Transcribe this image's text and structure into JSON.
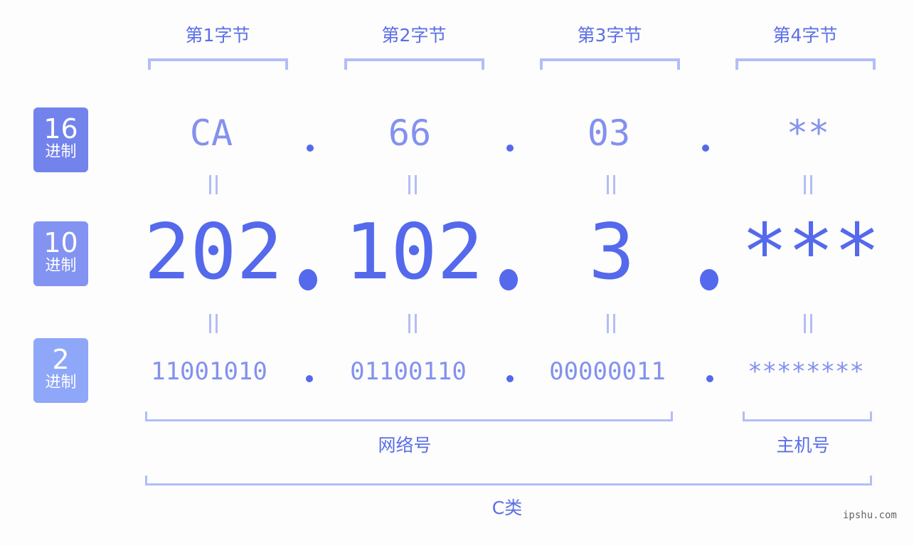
{
  "byte_labels": [
    "第1字节",
    "第2字节",
    "第3字节",
    "第4字节"
  ],
  "badges": [
    {
      "num": "16",
      "unit": "进制",
      "color": "#7383ec"
    },
    {
      "num": "10",
      "unit": "进制",
      "color": "#8293f2"
    },
    {
      "num": "2",
      "unit": "进制",
      "color": "#8fa7f8"
    }
  ],
  "hex": [
    "CA",
    "66",
    "03",
    "**"
  ],
  "decimal": [
    "202",
    "102",
    "3",
    "***"
  ],
  "binary": [
    "11001010",
    "01100110",
    "00000011",
    "********"
  ],
  "separator": ".",
  "groups": {
    "network": "网络号",
    "host": "主机号",
    "class": "C类"
  },
  "watermark": "ipshu.com",
  "colors": {
    "accent": "#5469ec",
    "light": "#8391ef",
    "bracket": "#b3bdf8"
  }
}
